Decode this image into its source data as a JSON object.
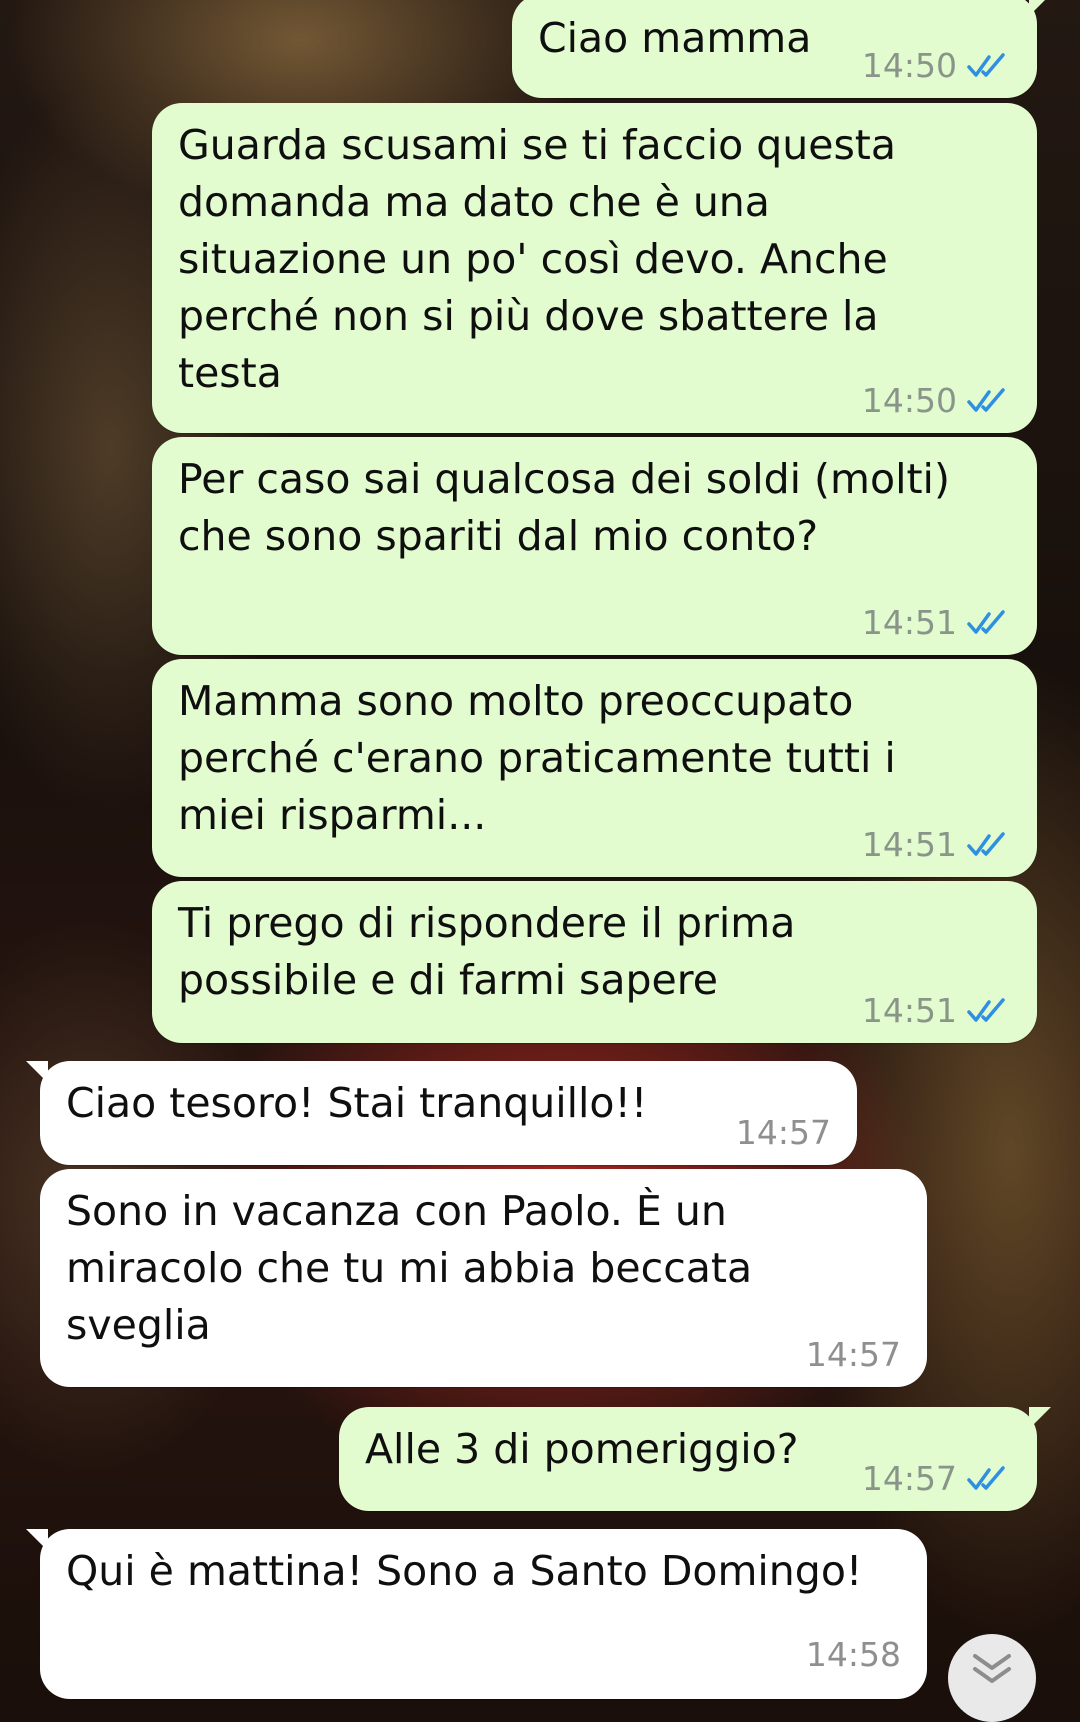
{
  "messages": [
    {
      "direction": "out",
      "text": "Ciao mamma",
      "time": "14:50",
      "status": "read"
    },
    {
      "direction": "out",
      "text": "Guarda scusami se ti faccio questa\ndomanda ma dato che è una\nsituazione un po' così devo. Anche\nperché non si più dove sbattere la\ntesta",
      "time": "14:50",
      "status": "read"
    },
    {
      "direction": "out",
      "text": "Per caso sai qualcosa dei soldi (molti)\nche sono spariti dal mio conto?",
      "time": "14:51",
      "status": "read"
    },
    {
      "direction": "out",
      "text": "Mamma sono molto preoccupato\nperché c'erano praticamente tutti i\nmiei risparmi...",
      "time": "14:51",
      "status": "read"
    },
    {
      "direction": "out",
      "text": "Ti prego di rispondere il prima\npossibile e di farmi sapere",
      "time": "14:51",
      "status": "read"
    },
    {
      "direction": "in",
      "text": "Ciao tesoro! Stai tranquillo!!",
      "time": "14:57"
    },
    {
      "direction": "in",
      "text": "Sono in vacanza con Paolo. È un\nmiracolo che tu mi abbia beccata\nsveglia",
      "time": "14:57"
    },
    {
      "direction": "out",
      "text": "Alle 3 di pomeriggio?",
      "time": "14:57",
      "status": "read"
    },
    {
      "direction": "in",
      "text": "Qui è mattina! Sono a Santo Domingo!",
      "time": "14:58"
    }
  ],
  "colors": {
    "outgoing_bubble": "#e2fbcf",
    "incoming_bubble": "#ffffff",
    "read_ticks": "#2f8fe0",
    "timestamp": "#8a958a"
  },
  "icons": {
    "read_receipt": "double-check-icon",
    "scroll_down": "chevron-double-down-icon"
  }
}
